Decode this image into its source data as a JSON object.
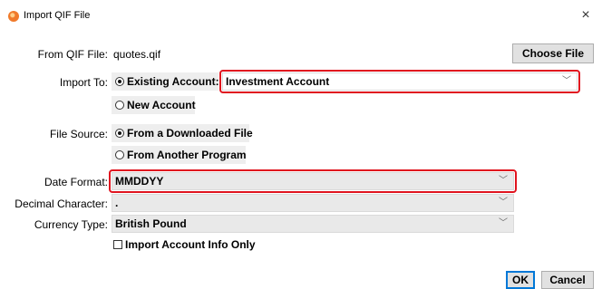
{
  "window": {
    "title": "Import QIF File",
    "close_glyph": "×"
  },
  "from_file": {
    "label": "From QIF File:",
    "value": "quotes.qif",
    "choose_label": "Choose File"
  },
  "import_to": {
    "label": "Import To:",
    "existing_label": "Existing Account:",
    "account_value": "Investment Account",
    "new_label": "New Account"
  },
  "file_source": {
    "label": "File Source:",
    "downloaded_label": "From a Downloaded File",
    "other_label": "From Another Program"
  },
  "date_format": {
    "label": "Date Format:",
    "value": "MMDDYY"
  },
  "decimal": {
    "label": "Decimal Character:",
    "value": "."
  },
  "currency": {
    "label": "Currency Type:",
    "value": "British Pound"
  },
  "account_info_only": {
    "label": "Import Account Info Only",
    "checked": false
  },
  "buttons": {
    "ok": "OK",
    "cancel": "Cancel"
  },
  "icons": {
    "app": "qif-app-icon",
    "close": "close-icon",
    "dropdown": "chevron-down-icon"
  },
  "colors": {
    "highlight": "#e0141f",
    "ok_focus": "#0078d7"
  }
}
